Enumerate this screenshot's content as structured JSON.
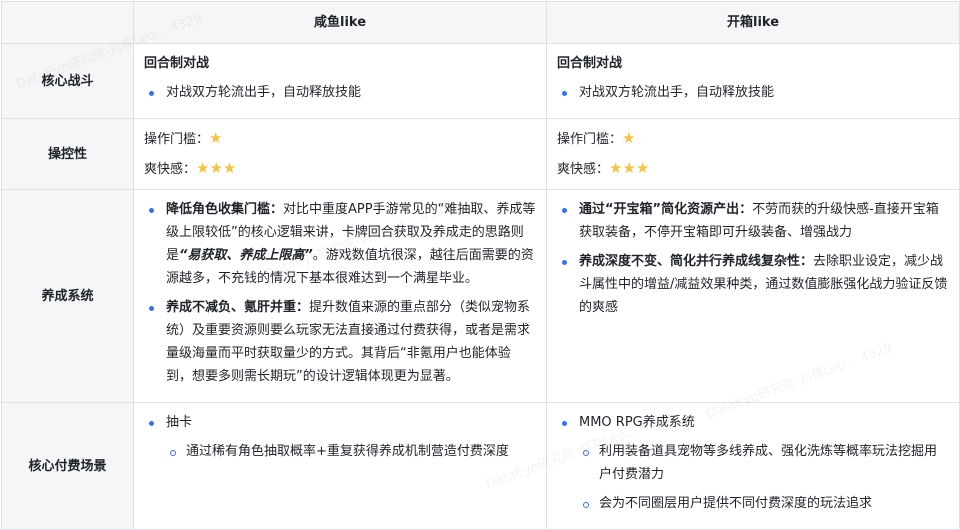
{
  "headers": [
    "",
    "咸鱼like",
    "开箱like"
  ],
  "rows": {
    "combat": {
      "label": "核心战斗",
      "a_title": "回合制对战",
      "a_item": "对战双方轮流出手，自动释放技能",
      "b_title": "回合制对战",
      "b_item": "对战双方轮流出手，自动释放技能"
    },
    "control": {
      "label": "操控性",
      "threshold": "操作门槛：",
      "fun": "爽快感：",
      "a_threshold_stars": 1,
      "a_fun_stars": 3,
      "b_threshold_stars": 1,
      "b_fun_stars": 3,
      "star": "★",
      "a_threshold": "★",
      "a_fun": "★★★",
      "b_threshold": "★",
      "b_fun": "★★★"
    },
    "growth": {
      "label": "养成系统",
      "a1_bold": "降低角色收集门槛：",
      "a1_text1": "对比中重度APP手游常见的“难抽取、养成等级上限较低”的核心逻辑来讲，卡牌回合获取及养成走的思路则是",
      "a1_em": "“易获取、养成上限高”",
      "a1_text2": "。游戏数值坑很深，越往后面需要的资源越多，不充钱的情况下基本很难达到一个满星毕业。",
      "a2_bold": "养成不减负、氪肝并重：",
      "a2_text": "提升数值来源的重点部分（类似宠物系统）及重要资源则要么玩家无法直接通过付费获得，或者是需求量级海量而平时获取量少的方式。其背后“非氪用户也能体验到，想要多则需长期玩”的设计逻辑体现更为显著。",
      "b1_bold": "通过“开宝箱”简化资源产出：",
      "b1_text": "不劳而获的升级快感-直接开宝箱获取装备，不停开宝箱即可升级装备、增强战力",
      "b2_bold": "养成深度不变、简化并行养成线复杂性：",
      "b2_text": "去除职业设定，减少战斗属性中的增益/减益效果种类，通过数值膨胀强化战力验证反馈的爽感"
    },
    "pay": {
      "label": "核心付费场景",
      "a1": "抽卡",
      "a1_sub": "通过稀有角色抽取概率+重复获得养成机制营造付费深度",
      "b1": "MMO RPG养成系统",
      "b1_sub1": "利用装备道具宠物等多线养成、强化洗炼等概率玩法挖掘用户付费潜力",
      "b1_sub2": "会为不同圈层用户提供不同付费深度的玩法追求"
    }
  },
  "watermark": "DataEye研究院-刘尊Leo... 4329"
}
